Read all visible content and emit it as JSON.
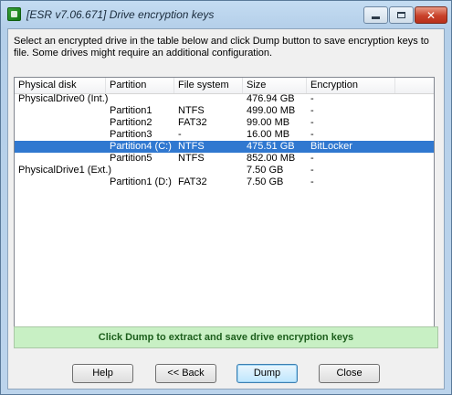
{
  "window": {
    "title": "[ESR v7.06.671]  Drive encryption keys",
    "controls": {
      "minimize": "",
      "maximize": "",
      "close": "✕"
    }
  },
  "instructions": "Select an encrypted drive in the table below and click Dump button to save encryption keys to file. Some drives might require an additional configuration.",
  "table": {
    "columns": [
      "Physical disk",
      "Partition",
      "File system",
      "Size",
      "Encryption"
    ],
    "rows": [
      [
        "PhysicalDrive0 (Int.)",
        "",
        "",
        "476.94 GB",
        "-"
      ],
      [
        "",
        "Partition1",
        "NTFS",
        "499.00 MB",
        "-"
      ],
      [
        "",
        "Partition2",
        "FAT32",
        "99.00 MB",
        "-"
      ],
      [
        "",
        "Partition3",
        "-",
        "16.00 MB",
        "-"
      ],
      [
        "",
        "Partition4 (C:)",
        "NTFS",
        "475.51 GB",
        "BitLocker"
      ],
      [
        "",
        "Partition5",
        "NTFS",
        "852.00 MB",
        "-"
      ],
      [
        "PhysicalDrive1 (Ext.)",
        "",
        "",
        "7.50 GB",
        "-"
      ],
      [
        "",
        "Partition1 (D:)",
        "FAT32",
        "7.50 GB",
        "-"
      ]
    ],
    "selected_row": 4
  },
  "status_message": "Click Dump to extract and save drive encryption keys",
  "buttons": {
    "help": "Help",
    "back": "<< Back",
    "dump": "Dump",
    "close": "Close"
  }
}
